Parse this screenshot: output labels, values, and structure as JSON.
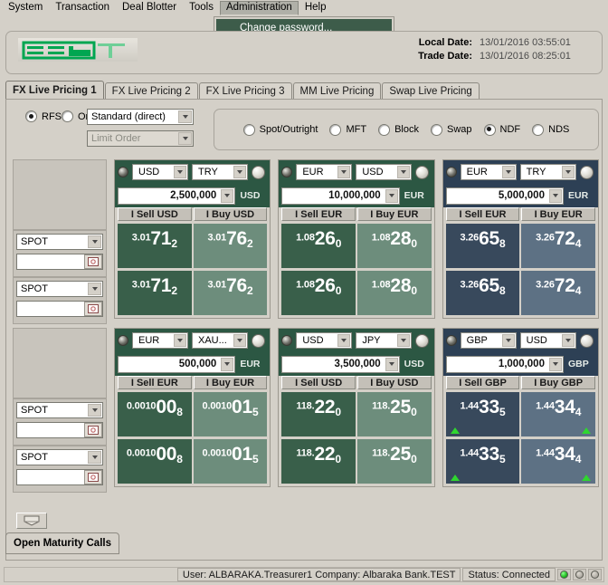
{
  "menu": {
    "items": [
      {
        "label": "System",
        "active": false
      },
      {
        "label": "Transaction",
        "active": false
      },
      {
        "label": "Deal Blotter",
        "active": false
      },
      {
        "label": "Tools",
        "active": false
      },
      {
        "label": "Administration",
        "active": true
      },
      {
        "label": "Help",
        "active": false
      }
    ],
    "open_dropdown": {
      "owner": "Administration",
      "items": [
        "Change password..."
      ]
    }
  },
  "header": {
    "logo_text": "360T",
    "local_date_label": "Local Date:",
    "local_date_value": "13/01/2016 03:55:01",
    "trade_date_label": "Trade Date:",
    "trade_date_value": "13/01/2016 08:25:01"
  },
  "tabs": [
    {
      "label": "FX Live Pricing 1",
      "selected": true
    },
    {
      "label": "FX Live Pricing 2",
      "selected": false
    },
    {
      "label": "FX Live Pricing 3",
      "selected": false
    },
    {
      "label": "MM Live Pricing",
      "selected": false
    },
    {
      "label": "Swap Live Pricing",
      "selected": false
    }
  ],
  "options": {
    "mode_radios": [
      {
        "label": "RFS",
        "selected": true
      },
      {
        "label": "Order",
        "selected": false
      }
    ],
    "rfs_select_value": "Standard (direct)",
    "order_select_value": "Limit Order",
    "order_select_disabled": true,
    "deal_types": [
      {
        "label": "Spot/Outright",
        "selected": false
      },
      {
        "label": "MFT",
        "selected": false
      },
      {
        "label": "Block",
        "selected": false
      },
      {
        "label": "Swap",
        "selected": false
      },
      {
        "label": "NDF",
        "selected": true
      },
      {
        "label": "NDS",
        "selected": false
      }
    ]
  },
  "tenor_column": {
    "rows": [
      {
        "tenor": "SPOT",
        "date": ""
      },
      {
        "tenor": "SPOT",
        "date": ""
      },
      {
        "tenor": "SPOT",
        "date": ""
      },
      {
        "tenor": "SPOT",
        "date": ""
      }
    ]
  },
  "quote_blocks": [
    {
      "theme": "green",
      "base_ccy": "USD",
      "quote_ccy": "TRY",
      "amount": "2,500,000",
      "amount_ccy": "USD",
      "sell_label": "I Sell USD",
      "buy_label": "I Buy USD",
      "rows": [
        {
          "sell": {
            "big_prefix": "3.01",
            "big": "71",
            "pip": "2",
            "tick": "none"
          },
          "buy": {
            "big_prefix": "3.01",
            "big": "76",
            "pip": "2",
            "tick": "none"
          }
        },
        {
          "sell": {
            "big_prefix": "3.01",
            "big": "71",
            "pip": "2",
            "tick": "none"
          },
          "buy": {
            "big_prefix": "3.01",
            "big": "76",
            "pip": "2",
            "tick": "none"
          }
        }
      ]
    },
    {
      "theme": "green",
      "base_ccy": "EUR",
      "quote_ccy": "USD",
      "amount": "10,000,000",
      "amount_ccy": "EUR",
      "sell_label": "I Sell EUR",
      "buy_label": "I Buy EUR",
      "rows": [
        {
          "sell": {
            "big_prefix": "1.08",
            "big": "26",
            "pip": "0",
            "tick": "none"
          },
          "buy": {
            "big_prefix": "1.08",
            "big": "28",
            "pip": "0",
            "tick": "none"
          }
        },
        {
          "sell": {
            "big_prefix": "1.08",
            "big": "26",
            "pip": "0",
            "tick": "none"
          },
          "buy": {
            "big_prefix": "1.08",
            "big": "28",
            "pip": "0",
            "tick": "none"
          }
        }
      ]
    },
    {
      "theme": "blue",
      "base_ccy": "EUR",
      "quote_ccy": "TRY",
      "amount": "5,000,000",
      "amount_ccy": "EUR",
      "sell_label": "I Sell EUR",
      "buy_label": "I Buy EUR",
      "rows": [
        {
          "sell": {
            "big_prefix": "3.26",
            "big": "65",
            "pip": "8",
            "tick": "none"
          },
          "buy": {
            "big_prefix": "3.26",
            "big": "72",
            "pip": "4",
            "tick": "none"
          }
        },
        {
          "sell": {
            "big_prefix": "3.26",
            "big": "65",
            "pip": "8",
            "tick": "none"
          },
          "buy": {
            "big_prefix": "3.26",
            "big": "72",
            "pip": "4",
            "tick": "none"
          }
        }
      ]
    },
    {
      "theme": "green",
      "base_ccy": "EUR",
      "quote_ccy": "XAU...",
      "amount": "500,000",
      "amount_ccy": "EUR",
      "sell_label": "I Sell EUR",
      "buy_label": "I Buy EUR",
      "rows": [
        {
          "sell": {
            "big_prefix": "0.0010",
            "big": "00",
            "pip": "8",
            "tick": "none"
          },
          "buy": {
            "big_prefix": "0.0010",
            "big": "01",
            "pip": "5",
            "tick": "none"
          }
        },
        {
          "sell": {
            "big_prefix": "0.0010",
            "big": "00",
            "pip": "8",
            "tick": "none"
          },
          "buy": {
            "big_prefix": "0.0010",
            "big": "01",
            "pip": "5",
            "tick": "none"
          }
        }
      ]
    },
    {
      "theme": "green",
      "base_ccy": "USD",
      "quote_ccy": "JPY",
      "amount": "3,500,000",
      "amount_ccy": "USD",
      "sell_label": "I Sell USD",
      "buy_label": "I Buy USD",
      "rows": [
        {
          "sell": {
            "big_prefix": "118.",
            "big": "22",
            "pip": "0",
            "tick": "none"
          },
          "buy": {
            "big_prefix": "118.",
            "big": "25",
            "pip": "0",
            "tick": "none"
          }
        },
        {
          "sell": {
            "big_prefix": "118.",
            "big": "22",
            "pip": "0",
            "tick": "none"
          },
          "buy": {
            "big_prefix": "118.",
            "big": "25",
            "pip": "0",
            "tick": "none"
          }
        }
      ]
    },
    {
      "theme": "blue",
      "base_ccy": "GBP",
      "quote_ccy": "USD",
      "amount": "1,000,000",
      "amount_ccy": "GBP",
      "sell_label": "I Sell GBP",
      "buy_label": "I Buy GBP",
      "rows": [
        {
          "sell": {
            "big_prefix": "1.44",
            "big": "33",
            "pip": "5",
            "tick": "up-left"
          },
          "buy": {
            "big_prefix": "1.44",
            "big": "34",
            "pip": "4",
            "tick": "up-right"
          }
        },
        {
          "sell": {
            "big_prefix": "1.44",
            "big": "33",
            "pip": "5",
            "tick": "up-left"
          },
          "buy": {
            "big_prefix": "1.44",
            "big": "34",
            "pip": "4",
            "tick": "up-right"
          }
        }
      ]
    }
  ],
  "footer": {
    "open_maturity_calls_label": "Open Maturity Calls",
    "user_status": "User: ALBARAKA.Treasurer1 Company: Albaraka Bank.TEST",
    "connection_status": "Status:  Connected",
    "lights": [
      "on",
      "off",
      "off"
    ]
  },
  "colors": {
    "green_header": "#2c5743",
    "green_sell": "#395f4a",
    "green_buy": "#6d8d7c",
    "blue_header": "#2d4055",
    "blue_sell": "#38495c",
    "blue_buy": "#5d7184",
    "menu_highlight": "#3d5c4a",
    "window_bg": "#d4d0c8",
    "uptick_green": "#2fd62f"
  }
}
